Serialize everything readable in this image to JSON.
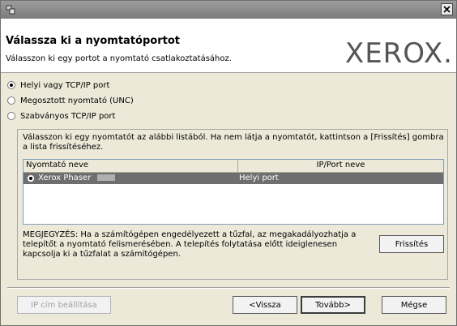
{
  "window": {
    "close_icon": "close-icon",
    "app_icon": "app-icon"
  },
  "header": {
    "title": "Válassza ki a nyomtatóportot",
    "subtitle": "Válasszon ki egy portot a nyomtató csatlakoztatásához.",
    "logo": "XEROX."
  },
  "port_options": [
    {
      "label": "Helyi vagy TCP/IP port",
      "checked": true
    },
    {
      "label": "Megosztott nyomtató (UNC)",
      "checked": false
    },
    {
      "label": "Szabványos TCP/IP port",
      "checked": false
    }
  ],
  "instruction": "Válasszon ki egy nyomtatót az alábbi listából. Ha nem látja a nyomtatót, kattintson a [Frissítés] gombra a lista frissítéséhez.",
  "printer_list": {
    "columns": [
      "Nyomtató neve",
      "IP/Port neve"
    ],
    "rows": [
      {
        "name": "Xerox Phaser",
        "port": "Helyi port",
        "selected": true
      }
    ]
  },
  "note": "MEGJEGYZÉS: Ha a számítógépen engedélyezett a tűzfal, az megakadályozhatja a telepítőt a nyomtató felismerésében. A telepítés folytatása előtt ideiglenesen kapcsolja ki a tűzfalat a számítógépen.",
  "buttons": {
    "refresh": "Frissítés",
    "ip_settings": "IP cím beállítása",
    "back": "<Vissza",
    "next": "Tovább>",
    "cancel": "Mégse"
  }
}
